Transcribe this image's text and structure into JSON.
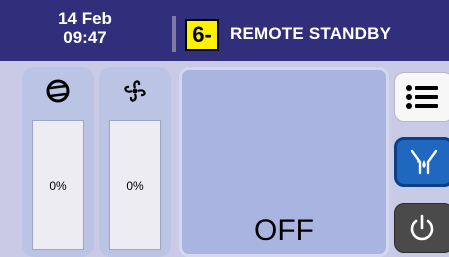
{
  "header": {
    "date": "14 Feb",
    "time": "09:47",
    "alarm_code": "6-",
    "status_title": "REMOTE STANDBY"
  },
  "meters": [
    {
      "icon": "compressor-icon",
      "value_label": "0%",
      "level": 0
    },
    {
      "icon": "fan-icon",
      "value_label": "0%",
      "level": 0
    }
  ],
  "main": {
    "state": "OFF"
  },
  "side_buttons": [
    {
      "icon": "menu-list-icon"
    },
    {
      "icon": "water-drain-icon"
    },
    {
      "icon": "power-icon"
    }
  ],
  "colors": {
    "header_bg": "#312f7c",
    "alarm_badge": "#fff200",
    "panel_bg": "#c9cbe6",
    "display_bg": "#a9b4e0",
    "active_button": "#1f67bf"
  }
}
